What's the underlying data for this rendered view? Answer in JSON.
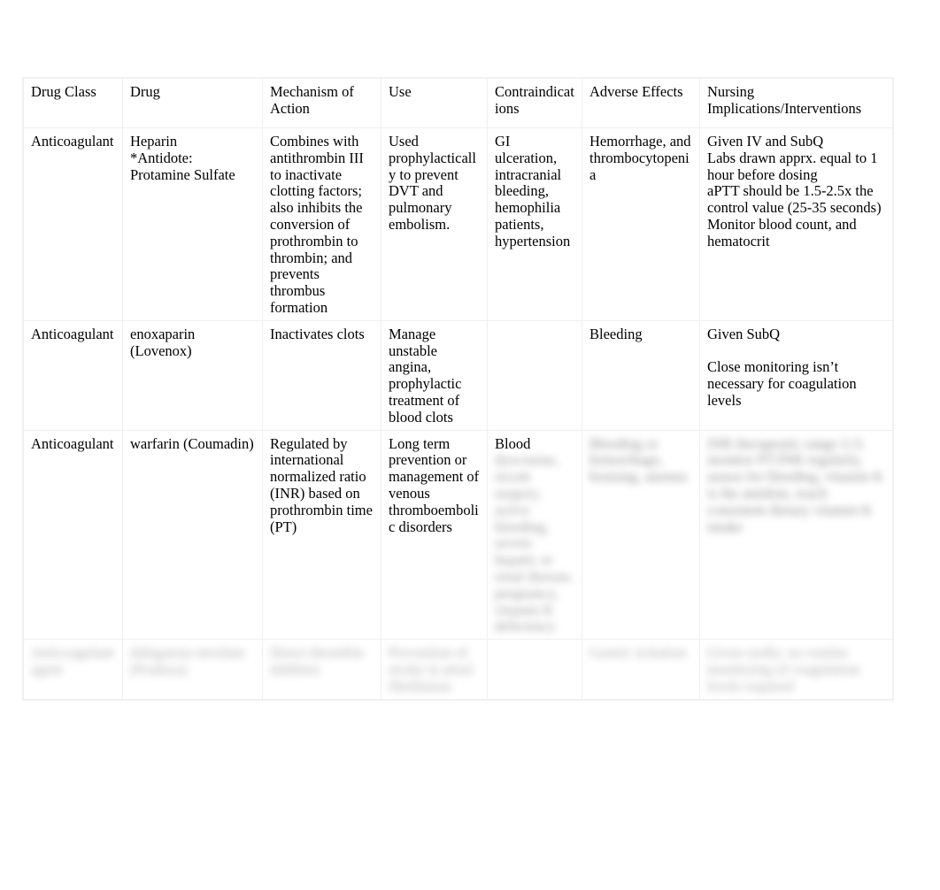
{
  "table": {
    "headers": [
      "Drug  Class",
      "Drug",
      "Mechanism  of Action",
      "Use",
      "Contraindications",
      "Adverse  Effects",
      "Nursing Implications/Interventions"
    ],
    "rows": [
      {
        "drug_class": "Anticoagulant",
        "drug": "Heparin\n*Antidote: Protamine Sulfate",
        "mechanism": "Combines with antithrombin III to inactivate clotting factors; also inhibits the conversion of prothrombin to thrombin; and prevents thrombus formation",
        "use": "Used prophylactically to prevent DVT and pulmonary embolism.",
        "contraindications": "GI ulceration, intracranial bleeding, hemophilia patients, hypertension",
        "adverse_effects": "Hemorrhage, and thrombocytopenia",
        "nursing": "Given IV and SubQ\nLabs drawn apprx. equal to 1 hour before dosing\naPTT should be 1.5-2.5x the control value (25-35 seconds)\nMonitor blood count, and hematocrit",
        "redacted": false
      },
      {
        "drug_class": "Anticoagulant",
        "drug": "enoxaparin (Lovenox)",
        "mechanism": "Inactivates clots",
        "use": "Manage unstable angina, prophylactic treatment of blood clots",
        "contraindications": "",
        "adverse_effects": "Bleeding",
        "nursing": "Given SubQ\n\nClose monitoring isn’t necessary for coagulation levels",
        "redacted": false
      },
      {
        "drug_class": "Anticoagulant",
        "drug": "warfarin (Coumadin)",
        "mechanism": "Regulated by international normalized ratio (INR) based on prothrombin time (PT)",
        "use": "Long term prevention or management of venous thromboembolic disorders",
        "contraindications_visible": "Blood",
        "contraindications_redacted": "dyscrasias, recent surgery, active bleeding, severe hepatic or renal disease, pregnancy, vitamin K deficiency",
        "adverse_effects_redacted": "Bleeding or hemorrhage, bruising, anemia",
        "nursing_redacted": "INR therapeutic range 2-3; monitor PT/INR regularly, assess for bleeding, vitamin K is the antidote, teach consistent dietary vitamin K intake",
        "redacted": true
      },
      {
        "drug_class_redacted": "Anticoagulant agent",
        "drug_redacted": "dabigatran etexilate (Pradaxa)",
        "mechanism_redacted": "Direct thrombin inhibitor",
        "use_redacted": "Prevention of stroke in atrial fibrillation",
        "adverse_effects_redacted": "Gastric irritation",
        "nursing_redacted": "Given orally; no routine monitoring of coagulation levels required",
        "redacted": true
      }
    ]
  },
  "appearance": {
    "page_background": "#ffffff",
    "text_color": "#000000",
    "grid_line_color": "#efefef"
  }
}
